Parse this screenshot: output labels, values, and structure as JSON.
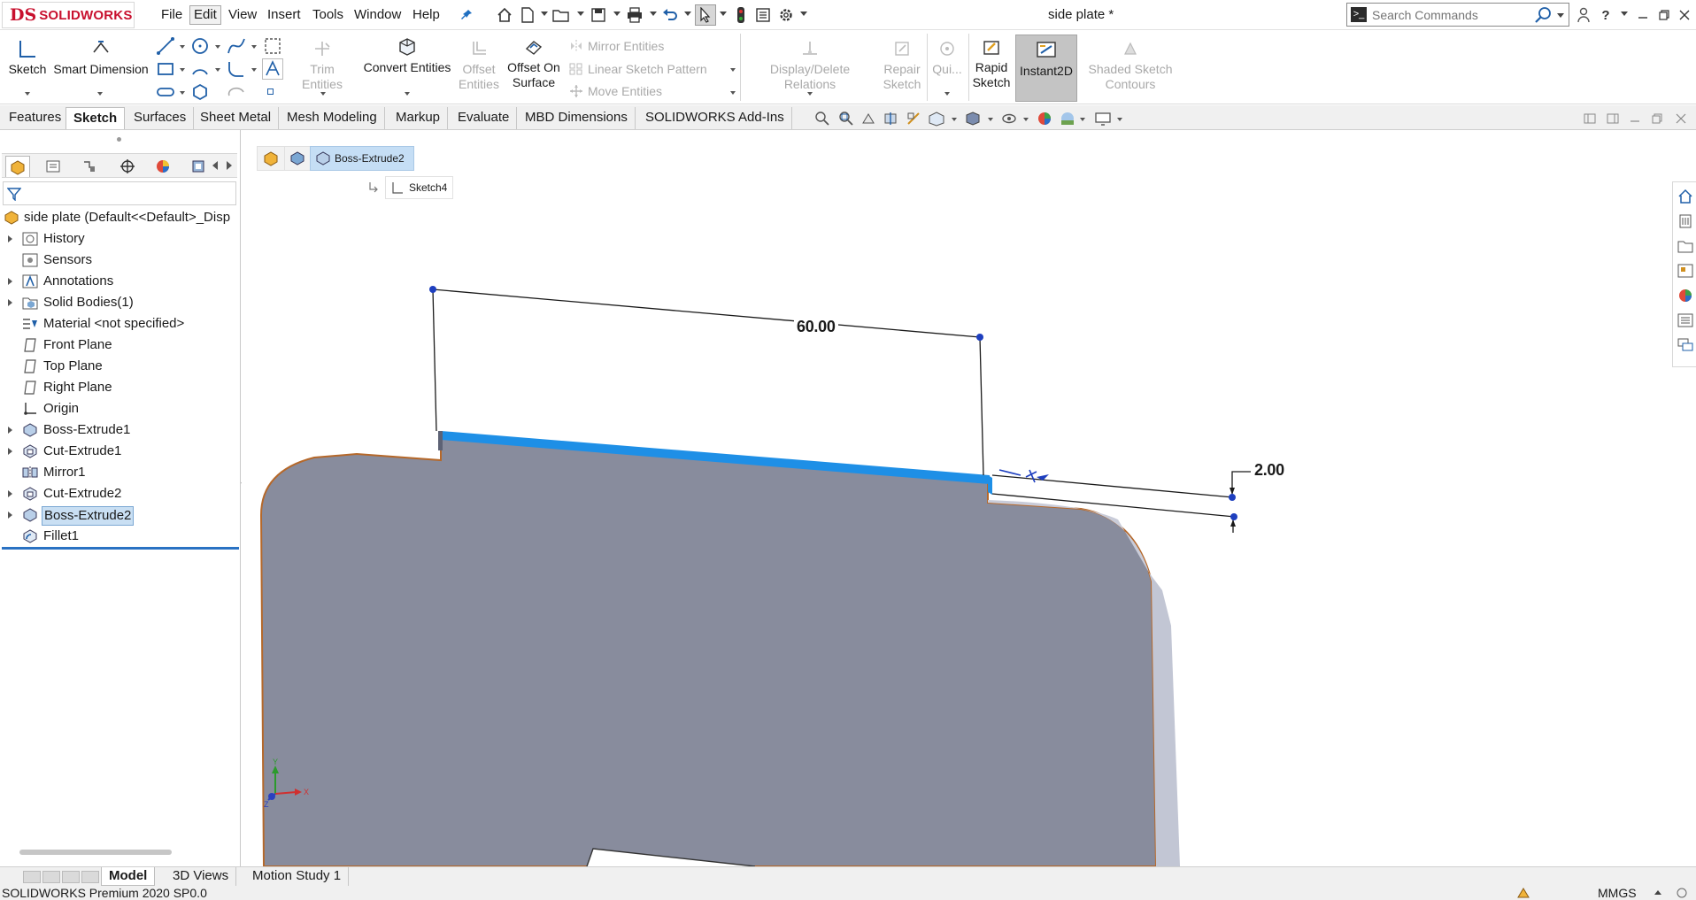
{
  "app": {
    "logo_mark": "DS",
    "logo_text": "SOLIDWORKS",
    "document_title": "side plate *"
  },
  "menu": [
    {
      "label": "File"
    },
    {
      "label": "Edit"
    },
    {
      "label": "View"
    },
    {
      "label": "Insert"
    },
    {
      "label": "Tools"
    },
    {
      "label": "Window"
    },
    {
      "label": "Help"
    }
  ],
  "search": {
    "placeholder": "Search Commands"
  },
  "ribbon": {
    "sketch": "Sketch",
    "smart_dimension": "Smart Dimension",
    "trim_entities": "Trim Entities",
    "convert_entities": "Convert Entities",
    "offset_entities_l1": "Offset",
    "offset_entities_l2": "Entities",
    "offset_on_surface_l1": "Offset On",
    "offset_on_surface_l2": "Surface",
    "mirror_entities": "Mirror Entities",
    "linear_sketch_pattern": "Linear Sketch Pattern",
    "move_entities": "Move Entities",
    "display_delete_relations": "Display/Delete Relations",
    "repair_sketch_l1": "Repair",
    "repair_sketch_l2": "Sketch",
    "quick_snaps": "Qui...",
    "rapid_sketch_l1": "Rapid",
    "rapid_sketch_l2": "Sketch",
    "instant2d": "Instant2D",
    "shaded_contours_l1": "Shaded Sketch",
    "shaded_contours_l2": "Contours"
  },
  "cm_tabs": [
    {
      "label": "Features"
    },
    {
      "label": "Sketch"
    },
    {
      "label": "Surfaces"
    },
    {
      "label": "Sheet Metal"
    },
    {
      "label": "Mesh Modeling"
    },
    {
      "label": "Markup"
    },
    {
      "label": "Evaluate"
    },
    {
      "label": "MBD Dimensions"
    },
    {
      "label": "SOLIDWORKS Add-Ins"
    }
  ],
  "tree": {
    "root": "side plate  (Default<<Default>_Disp",
    "items": [
      {
        "label": "History"
      },
      {
        "label": "Sensors"
      },
      {
        "label": "Annotations"
      },
      {
        "label": "Solid Bodies(1)"
      },
      {
        "label": "Material <not specified>"
      },
      {
        "label": "Front Plane"
      },
      {
        "label": "Top Plane"
      },
      {
        "label": "Right Plane"
      },
      {
        "label": "Origin"
      },
      {
        "label": "Boss-Extrude1"
      },
      {
        "label": "Cut-Extrude1"
      },
      {
        "label": "Mirror1"
      },
      {
        "label": "Cut-Extrude2"
      },
      {
        "label": "Boss-Extrude2"
      },
      {
        "label": "Fillet1"
      }
    ]
  },
  "viewport": {
    "breadcrumb_feature": "Boss-Extrude2",
    "breadcrumb_sketch": "Sketch4",
    "dimension_length": "60.00",
    "dimension_height": "2.00",
    "triad_y": "Y",
    "triad_x": "X",
    "triad_z": "Z"
  },
  "bottom_tabs": [
    {
      "label": "Model"
    },
    {
      "label": "3D Views"
    },
    {
      "label": "Motion Study 1"
    }
  ],
  "status": {
    "product": "SOLIDWORKS Premium 2020 SP0.0",
    "units": "MMGS"
  },
  "colors": {
    "brand_red": "#c8102e",
    "selection_blue": "#1e8fe6",
    "part_gray": "#888c9d",
    "part_edge": "#b5682a"
  }
}
